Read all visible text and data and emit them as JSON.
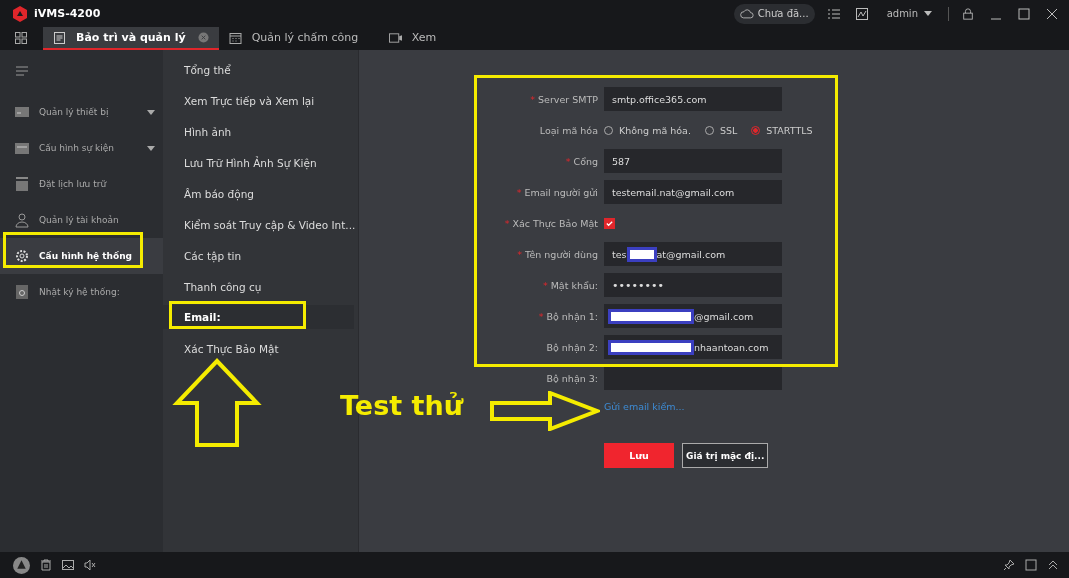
{
  "window": {
    "title": "iVMS-4200",
    "cloud_status": "Chưa đă...",
    "user": "admin"
  },
  "tabs": [
    {
      "label": "Bảo trì và quản lý",
      "selected": true,
      "closable": true,
      "kind": "maint"
    },
    {
      "label": "Quản lý chấm công",
      "selected": false,
      "closable": false,
      "kind": "calendar"
    },
    {
      "label": "Xem",
      "selected": false,
      "closable": false,
      "kind": "camera"
    }
  ],
  "sidebar": {
    "items": [
      {
        "label": "Quản lý thiết bị",
        "kind": "device",
        "selected": false,
        "expandable": true
      },
      {
        "label": "Cấu hình sự kiện",
        "kind": "event",
        "selected": false,
        "expandable": true
      },
      {
        "label": "Đặt lịch lưu trữ",
        "kind": "storage",
        "selected": false,
        "expandable": false
      },
      {
        "label": "Quản lý tài khoản",
        "kind": "user",
        "selected": false,
        "expandable": false
      },
      {
        "label": "Cấu hình hệ thống",
        "kind": "gear",
        "selected": true,
        "expandable": false
      },
      {
        "label": "Nhật ký hệ thống:",
        "kind": "log",
        "selected": false,
        "expandable": false
      }
    ]
  },
  "submenu": {
    "items": [
      {
        "label": "Tổng thể",
        "selected": false
      },
      {
        "label": "Xem Trực tiếp và Xem lại",
        "selected": false
      },
      {
        "label": "Hình ảnh",
        "selected": false
      },
      {
        "label": "Lưu Trữ Hình Ảnh Sự Kiện",
        "selected": false
      },
      {
        "label": "Âm báo động",
        "selected": false
      },
      {
        "label": "Kiểm soát Truy cập & Video Int...",
        "selected": false
      },
      {
        "label": "Các tập tin",
        "selected": false
      },
      {
        "label": "Thanh công cụ",
        "selected": false
      },
      {
        "label": "Email:",
        "selected": true
      },
      {
        "label": "Xác Thực Bảo Mật",
        "selected": false
      }
    ]
  },
  "form": {
    "rows": [
      {
        "kind": "text",
        "label": "Server SMTP",
        "required_mark": "*",
        "value": "smtp.office365.com"
      },
      {
        "kind": "radio",
        "label": "Loại mã hóa",
        "options": [
          {
            "label": "Không mã hóa.",
            "selected": false
          },
          {
            "label": "SSL",
            "selected": false
          },
          {
            "label": "STARTTLS",
            "selected": true
          }
        ]
      },
      {
        "kind": "text",
        "label": "Cổng",
        "required_mark": "*",
        "value": "587"
      },
      {
        "kind": "text",
        "label": "Email người gửi",
        "required_mark": "*",
        "value": "testemail.nat@gmail.com"
      },
      {
        "kind": "checkbox",
        "label": "Xác Thực Bảo Mật",
        "required_mark": "*",
        "checked": true
      },
      {
        "kind": "text",
        "label": "Tên người dùng",
        "required_mark": "*",
        "prefix": "tes",
        "redacted": true,
        "value": "at@gmail.com"
      },
      {
        "kind": "password",
        "label": "Mật khẩu:",
        "required_mark": "*",
        "value": "••••••••"
      },
      {
        "kind": "text",
        "label": "Bộ nhận 1:",
        "required_mark": "*",
        "redacted": true,
        "value": "@gmail.com"
      },
      {
        "kind": "text",
        "label": "Bộ nhận 2:",
        "redacted": true,
        "value": "nhaantoan.com"
      },
      {
        "kind": "text",
        "label": "Bộ nhận 3:"
      }
    ],
    "test_link": "Gửi email kiểm...",
    "buttons": [
      {
        "label": "Lưu",
        "kind": "primary"
      },
      {
        "label": "Giá trị mặc đị...",
        "kind": "secondary"
      }
    ]
  },
  "annotation": {
    "text": "Test thử"
  }
}
